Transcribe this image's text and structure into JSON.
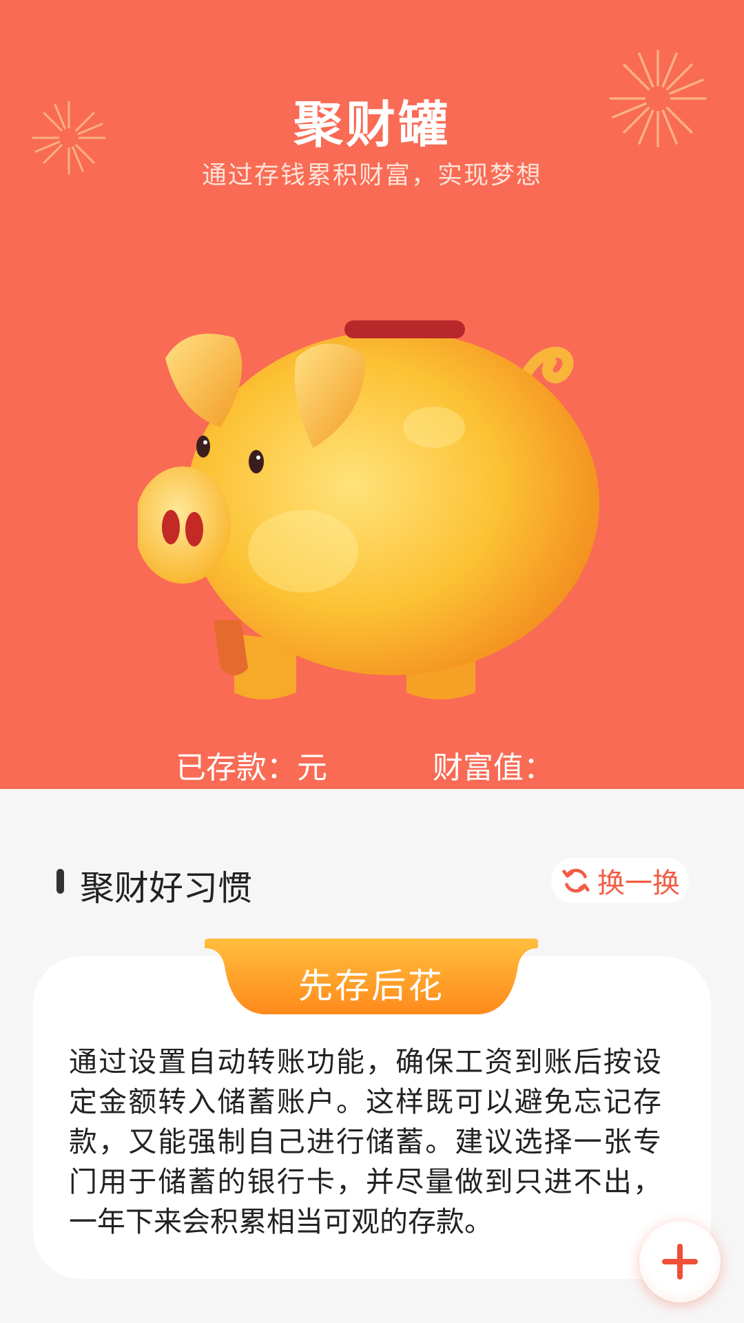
{
  "header": {
    "title": "聚财罐",
    "subtitle": "通过存钱累积财富，实现梦想"
  },
  "stats": {
    "saved_label": "已存款：元",
    "wealth_label": "财富值："
  },
  "habits": {
    "section_title": "聚财好习惯",
    "refresh_label": "换一换",
    "card_title": "先存后花",
    "card_text": "通过设置自动转账功能，确保工资到账后按设定金额转入储蓄账户。这样既可以避免忘记存款，又能强制自己进行储蓄。建议选择一张专门用于储蓄的银行卡，并尽量做到只进不出，一年下来会积累相当可观的存款。"
  },
  "icons": {
    "refresh": "refresh-icon",
    "add": "plus-icon",
    "hero_image": "piggy-bank-icon",
    "decoration": "firework-icon"
  },
  "colors": {
    "hero_background": "#f96b55",
    "accent": "#f25d44",
    "ribbon": "#ffa32a",
    "page_background": "#f6f6f6"
  }
}
